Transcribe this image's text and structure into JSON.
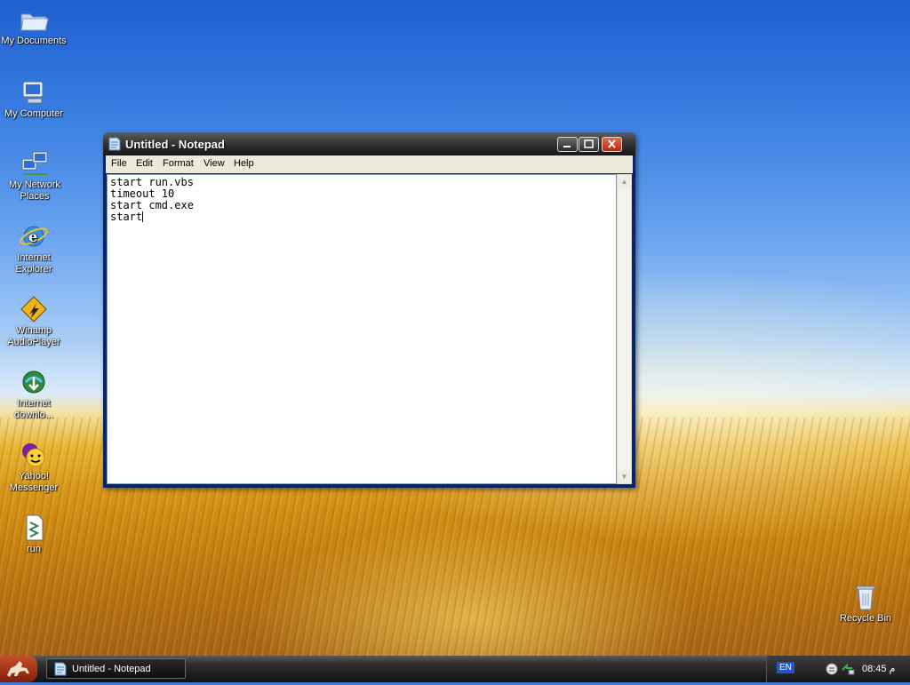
{
  "desktop": {
    "icons": [
      {
        "label": "My Documents"
      },
      {
        "label": "My Computer"
      },
      {
        "label": "My Network Places"
      },
      {
        "label": "Internet Explorer"
      },
      {
        "label": "Winamp AudioPlayer"
      },
      {
        "label": "Internet downlo..."
      },
      {
        "label": "Yahoo! Messenger"
      },
      {
        "label": "run"
      },
      {
        "label": "Recycle Bin"
      }
    ]
  },
  "window": {
    "title": "Untitled - Notepad",
    "menu": [
      "File",
      "Edit",
      "Format",
      "View",
      "Help"
    ],
    "content_lines": [
      "start run.vbs",
      "timeout 10",
      "start cmd.exe",
      "start"
    ]
  },
  "taskbar": {
    "task_label": "Untitled - Notepad",
    "language": "EN",
    "clock": "08:45 م"
  },
  "colors": {
    "titlebar": "#2a2a2a",
    "close_button": "#c8401f",
    "language_badge": "#2155c9"
  }
}
